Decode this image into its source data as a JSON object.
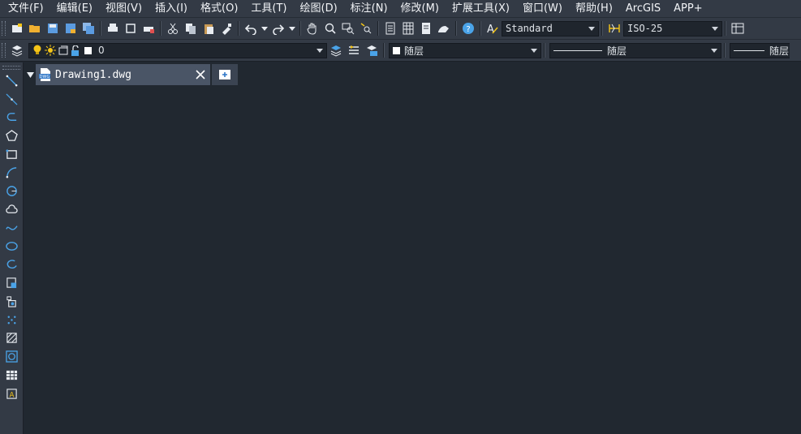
{
  "menu": [
    "文件(F)",
    "编辑(E)",
    "视图(V)",
    "插入(I)",
    "格式(O)",
    "工具(T)",
    "绘图(D)",
    "标注(N)",
    "修改(M)",
    "扩展工具(X)",
    "窗口(W)",
    "帮助(H)",
    "ArcGIS",
    "APP+"
  ],
  "styles": {
    "text_style": "Standard",
    "dim_style": "ISO-25"
  },
  "layer": {
    "name": "0"
  },
  "properties": {
    "color": "随层",
    "linetype": "随层",
    "lineweight": "随层"
  },
  "document": {
    "tab_title": "Drawing1.dwg"
  },
  "colors": {
    "accent": "#4aa3e8",
    "canvas": "#212830",
    "panel": "#333a45",
    "tab_active": "#4a5566",
    "bulb": "#f5c518"
  }
}
